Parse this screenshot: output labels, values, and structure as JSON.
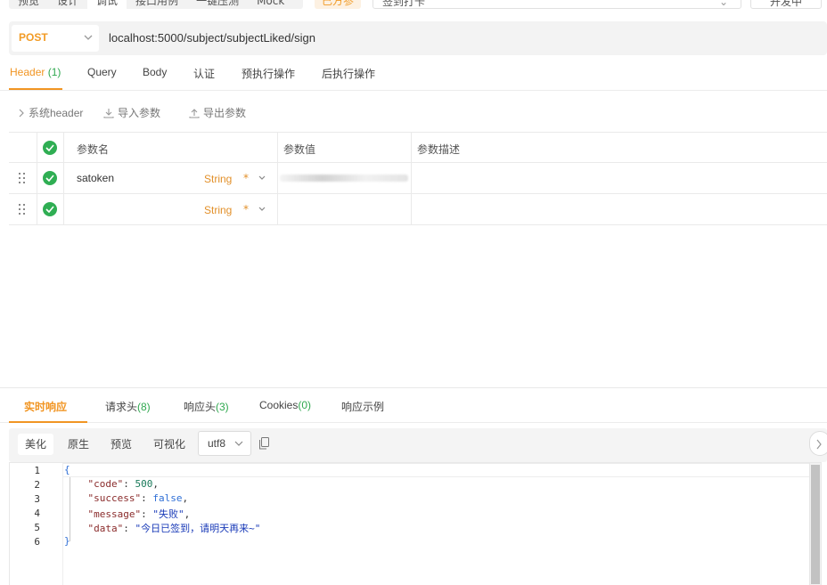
{
  "top_toolbar": {
    "tabs": [
      "预览",
      "设计",
      "调试",
      "接口用例",
      "一键压测",
      "Mock"
    ],
    "active_tab": "调试",
    "env_button": "已方参",
    "env_select_value": "签到打卡",
    "action_button": "开发中"
  },
  "request": {
    "method": "POST",
    "url": "localhost:5000/subject/subjectLiked/sign"
  },
  "request_tabs": {
    "header": "Header",
    "header_count": "(1)",
    "query": "Query",
    "body": "Body",
    "auth": "认证",
    "pre": "预执行操作",
    "post": "后执行操作"
  },
  "header_actions": {
    "system_header": "系统header",
    "import": "导入参数",
    "export": "导出参数"
  },
  "params_table": {
    "columns": {
      "name": "参数名",
      "value": "参数值",
      "description": "参数描述"
    },
    "rows": [
      {
        "name": "satoken",
        "type": "String",
        "required": "*",
        "value": "",
        "description": ""
      },
      {
        "name": "",
        "type": "String",
        "required": "*",
        "value": "",
        "description": ""
      }
    ]
  },
  "response_tabs": {
    "realtime": "实时响应",
    "req_headers": "请求头",
    "req_headers_count": "(8)",
    "resp_headers": "响应头",
    "resp_headers_count": "(3)",
    "cookies": "Cookies",
    "cookies_count": "(0)",
    "example": "响应示例"
  },
  "response_toolbar": {
    "pretty": "美化",
    "raw": "原生",
    "preview": "预览",
    "visualize": "可视化",
    "encoding": "utf8"
  },
  "response_body": {
    "line_numbers": [
      "1",
      "2",
      "3",
      "4",
      "5",
      "6"
    ],
    "open_brace": "{",
    "close_brace": "}",
    "code_key": "\"code\"",
    "code_value": "500",
    "success_key": "\"success\"",
    "success_value": "false",
    "message_key": "\"message\"",
    "message_value": "\"失败\"",
    "data_key": "\"data\"",
    "data_value": "\"今日已签到，请明天再来~\""
  },
  "colors": {
    "accent": "#f19523",
    "success_green": "#2fae53",
    "type_orange": "#e2902a"
  }
}
